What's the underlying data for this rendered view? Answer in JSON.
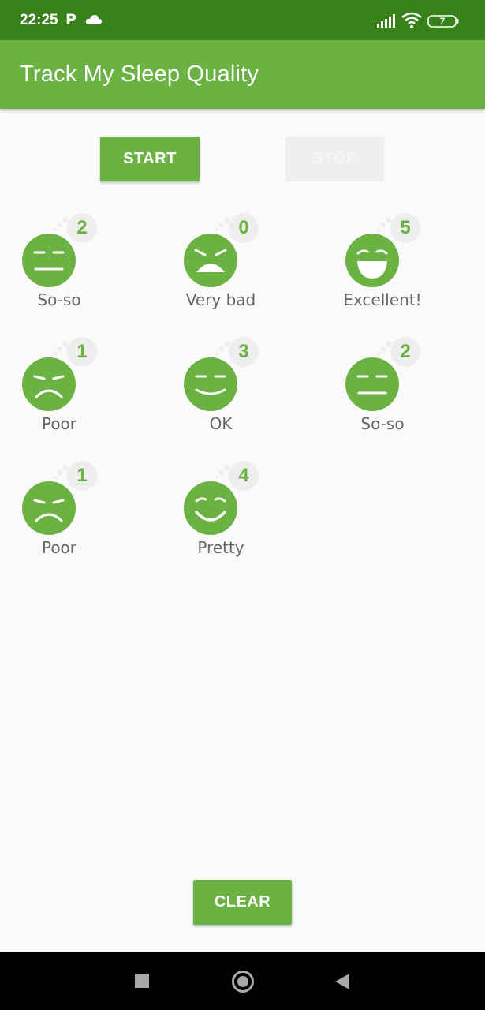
{
  "status_bar": {
    "time": "22:25",
    "carrier_icon_letter": "P",
    "battery_level": "7",
    "icons": [
      "cloud-icon",
      "signal-icon",
      "wifi-icon",
      "battery-icon"
    ]
  },
  "app_bar": {
    "title": "Track My Sleep Quality"
  },
  "actions": {
    "start_label": "START",
    "stop_label": "STOP",
    "clear_label": "CLEAR"
  },
  "nights": [
    {
      "quality": 2,
      "label": "So-so",
      "icon": "so-so-face-icon"
    },
    {
      "quality": 0,
      "label": "Very bad",
      "icon": "very-bad-face-icon"
    },
    {
      "quality": 5,
      "label": "Excellent!",
      "icon": "excellent-face-icon"
    },
    {
      "quality": 1,
      "label": "Poor",
      "icon": "poor-face-icon"
    },
    {
      "quality": 3,
      "label": "OK",
      "icon": "ok-face-icon"
    },
    {
      "quality": 2,
      "label": "So-so",
      "icon": "so-so-face-icon"
    },
    {
      "quality": 1,
      "label": "Poor",
      "icon": "poor-face-icon"
    },
    {
      "quality": 4,
      "label": "Pretty",
      "icon": "pretty-good-face-icon"
    }
  ],
  "colors": {
    "primary": "#6ab343",
    "primary_dark": "#388018",
    "background": "#fafafa",
    "label_text": "#666666",
    "badge_bg": "#eeeeee",
    "disabled_button": "#efefef"
  },
  "nav_bar": {
    "icons": [
      "recents-icon",
      "home-icon",
      "back-icon"
    ]
  }
}
